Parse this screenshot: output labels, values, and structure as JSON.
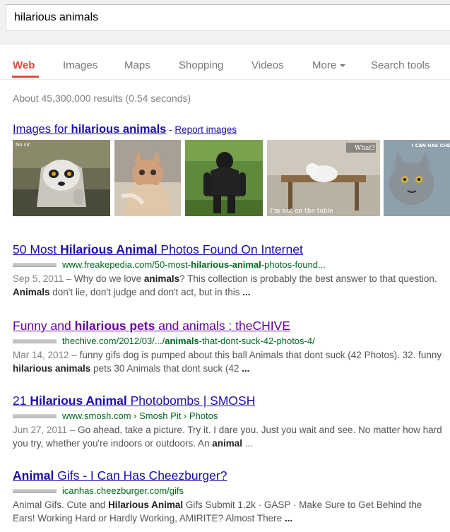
{
  "search": {
    "query": "hilarious animals"
  },
  "tabs": [
    {
      "label": "Web"
    },
    {
      "label": "Images"
    },
    {
      "label": "Maps"
    },
    {
      "label": "Shopping"
    },
    {
      "label": "Videos"
    },
    {
      "label": "More"
    },
    {
      "label": "Search tools"
    }
  ],
  "stats": "About 45,300,000 results (0.54 seconds)",
  "images": {
    "title_prefix": "Images for ",
    "title_query": "hilarious animals",
    "dash": " - ",
    "report": "Report images",
    "captions": {
      "lemur": "No sir",
      "cat_speech": "What?",
      "cat_caption": "I'm not on the table",
      "cheezburger": "I CAN HAS CHEEZBURGER?"
    }
  },
  "results": [
    {
      "title": [
        "50 Most ",
        "Hilarious Animal",
        " Photos Found On Internet"
      ],
      "url": [
        "www.freakepedia.com/50-most-",
        "hilarious-animal",
        "-photos-found..."
      ],
      "date": "Sep 5, 2011",
      "snippet_1": [
        "Why do we love ",
        "animals",
        "? This collection is probably the best answer to that question. "
      ],
      "snippet_2": [
        "Animals",
        " don't lie, don't judge and don't act, but in this ",
        "..."
      ]
    },
    {
      "title": [
        "Funny and ",
        "hilarious pets",
        " and animals : theCHIVE"
      ],
      "url": [
        "thechive.com/2012/03/.../",
        "animals",
        "-that-dont-suck-42-photos-4/"
      ],
      "date": "Mar 14, 2012",
      "snippet_1": [
        "funny gifs dog is pumped about this ball Animals that dont suck (42 Photos). 32. funny "
      ],
      "snippet_2": [
        "hilarious animals",
        " pets 30 Animals that dont suck (42 ",
        "..."
      ]
    },
    {
      "title": [
        "21 ",
        "Hilarious Animal",
        " Photobombs | SMOSH"
      ],
      "url": [
        "www.smosh.com › Smosh Pit › Photos"
      ],
      "date": "Jun 27, 2011",
      "snippet_1": [
        "Go ahead, take a picture. Try it. I dare you. Just you wait and see. No matter how hard you try, whether you're indoors or outdoors. An "
      ],
      "snippet_2": [
        "animal",
        " ..."
      ]
    },
    {
      "title": [
        "Animal",
        " Gifs - I Can Has Cheezburger?"
      ],
      "url": [
        "icanhas.cheezburger.com/gifs"
      ],
      "snippet_1": [
        "Animal Gifs. Cute and "
      ],
      "snippet_2": [
        "Hilarious Animal",
        " Gifs Submit 1.2k · GASP · Make Sure to Get Behind the Ears! Working Hard or Hardly Working, AMIRITE? Almost There ",
        "..."
      ]
    }
  ],
  "separator": " – "
}
